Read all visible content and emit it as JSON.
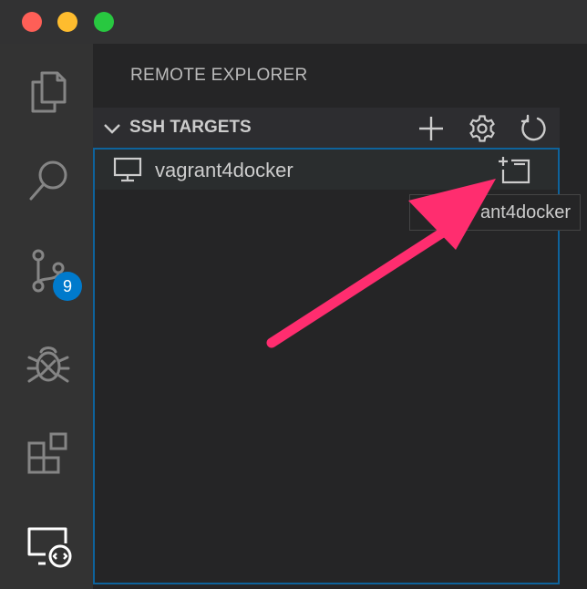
{
  "window": {
    "controls": [
      "close",
      "minimize",
      "maximize"
    ]
  },
  "activity_bar": {
    "items": [
      {
        "name": "explorer",
        "icon": "files-icon"
      },
      {
        "name": "search",
        "icon": "search-icon"
      },
      {
        "name": "source-control",
        "icon": "source-control-icon",
        "badge": "9"
      },
      {
        "name": "debug",
        "icon": "bug-icon"
      },
      {
        "name": "extensions",
        "icon": "extensions-icon"
      },
      {
        "name": "remote-explorer",
        "icon": "remote-explorer-icon",
        "active": true
      }
    ]
  },
  "sidebar": {
    "title": "REMOTE EXPLORER",
    "section": {
      "label": "SSH TARGETS",
      "expanded": true,
      "actions": [
        "add-icon",
        "gear-icon",
        "refresh-icon"
      ],
      "items": [
        {
          "label": "vagrant4docker",
          "icon": "monitor-icon",
          "action_icon": "open-in-new-window-icon"
        }
      ]
    }
  },
  "tooltip": {
    "visible_text": "ant4docker"
  },
  "colors": {
    "accent": "#007acc",
    "focus_border": "#0e639c",
    "annotation_arrow": "#ff2d6f"
  }
}
